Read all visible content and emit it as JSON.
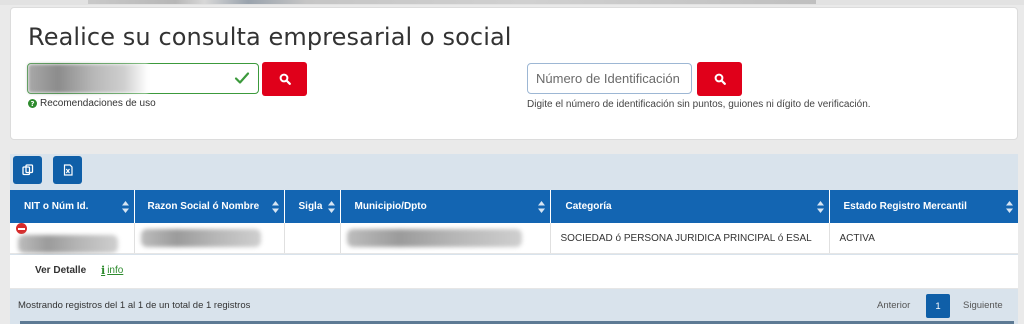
{
  "search": {
    "title": "Realice su consulta empresarial o social",
    "name_input_value": "",
    "recommendations_label": "Recomendaciones de uso",
    "id_placeholder": "Número de Identificación",
    "id_help": "Digite el número de identificación sin puntos, guiones ni dígito de verificación.",
    "accent_color": "#e0001a",
    "valid_color": "#3c9a3c"
  },
  "toolbar": {
    "copy_icon": "copy-icon",
    "excel_icon": "excel-icon"
  },
  "table": {
    "columns": [
      "NIT o Núm Id.",
      "Razon Social ó Nombre",
      "Sigla",
      "Municipio/Dpto",
      "Categoría",
      "Estado Registro Mercantil"
    ],
    "rows": [
      {
        "nit": "",
        "razon_social": "",
        "sigla": "",
        "municipio": "",
        "categoria": "SOCIEDAD ó PERSONA JURIDICA PRINCIPAL ó ESAL",
        "estado": "ACTIVA"
      }
    ],
    "header_color": "#1365b2"
  },
  "detail": {
    "label": "Ver Detalle",
    "info_link": "info"
  },
  "footer": {
    "summary": "Mostrando registros del 1 al 1 de un total de 1 registros",
    "prev_label": "Anterior",
    "current_page": "1",
    "next_label": "Siguiente"
  }
}
